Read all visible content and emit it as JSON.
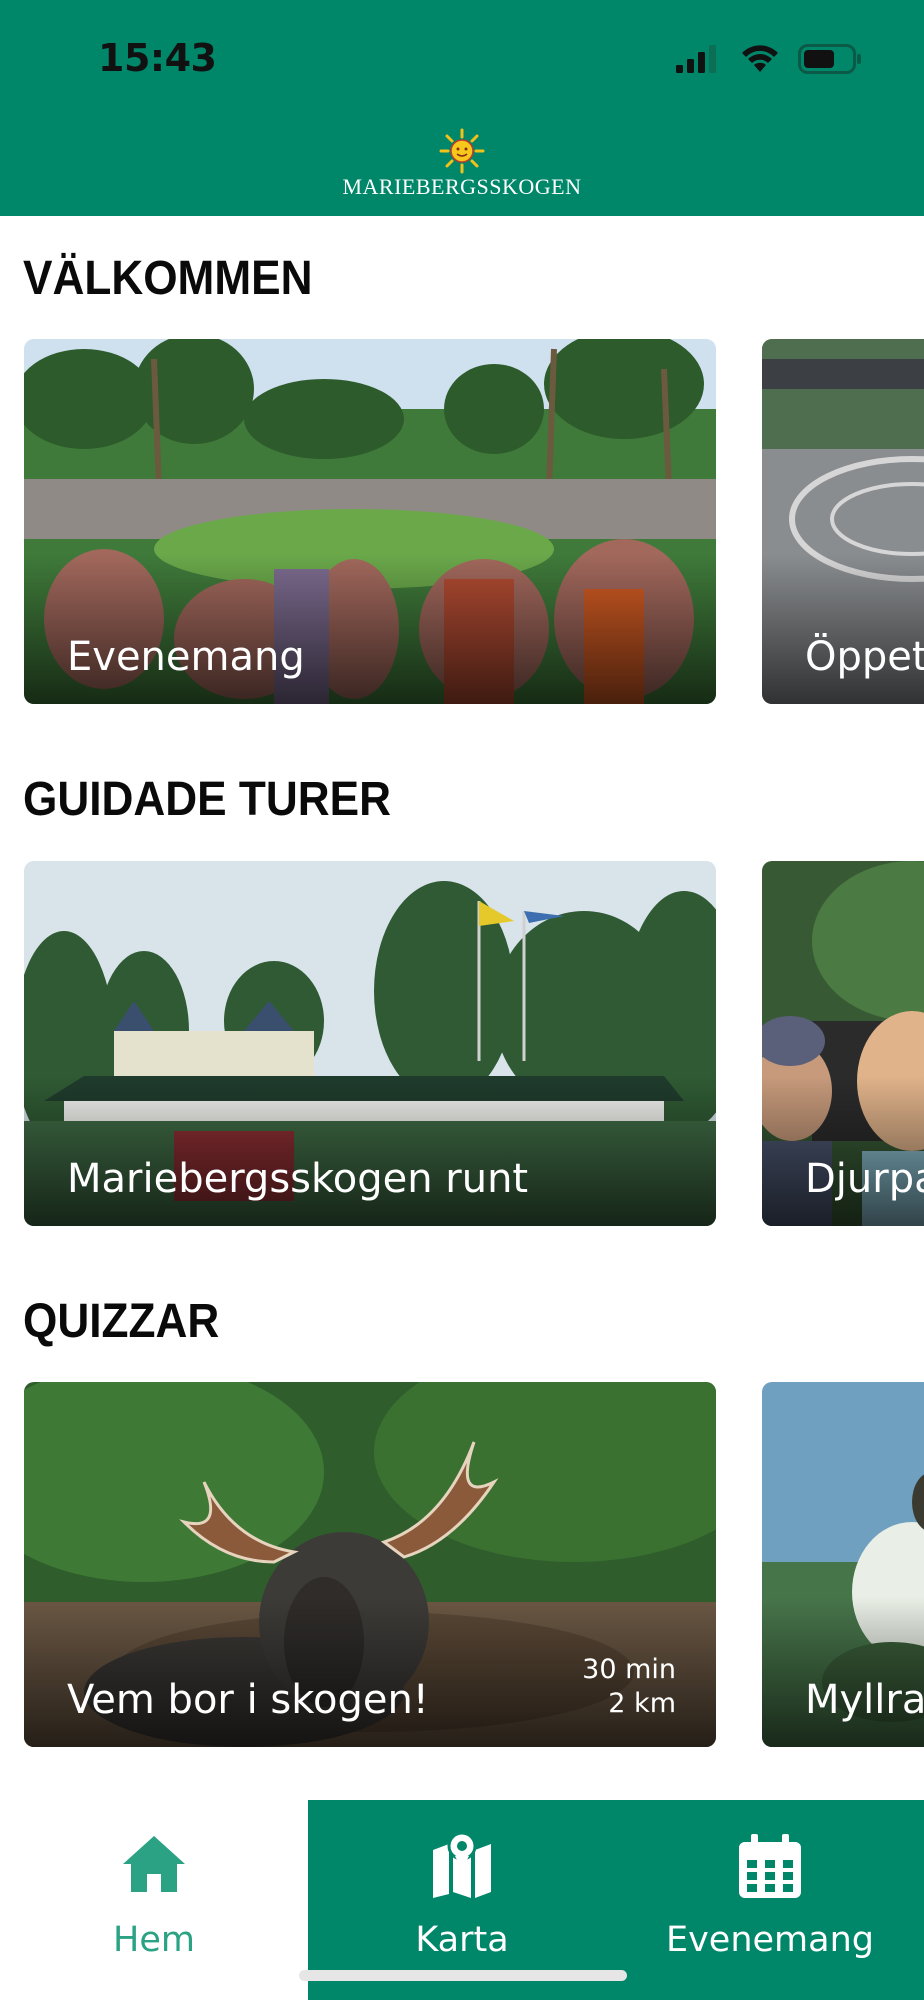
{
  "status": {
    "time": "15:43"
  },
  "header": {
    "brand": "MARIEBERGSSKOGEN"
  },
  "sections": [
    {
      "title": "VÄLKOMMEN",
      "card": {
        "label": "Evenemang"
      },
      "peek": {
        "label": "Öppettider"
      }
    },
    {
      "title": "GUIDADE TURER",
      "card": {
        "label": "Mariebergsskogen runt"
      },
      "peek": {
        "label": "Djurparken"
      }
    },
    {
      "title": "QUIZZAR",
      "card": {
        "label": "Vem bor i skogen!",
        "duration": "30 min",
        "distance": "2 km"
      },
      "peek": {
        "label": "Myllra"
      }
    }
  ],
  "tabs": [
    {
      "label": "Hem",
      "icon": "home-icon",
      "active": true
    },
    {
      "label": "Karta",
      "icon": "map-icon",
      "active": false
    },
    {
      "label": "Evenemang",
      "icon": "calendar-icon",
      "active": false
    }
  ],
  "colors": {
    "brand": "#00876a",
    "active_tab_text": "#2aa283"
  }
}
